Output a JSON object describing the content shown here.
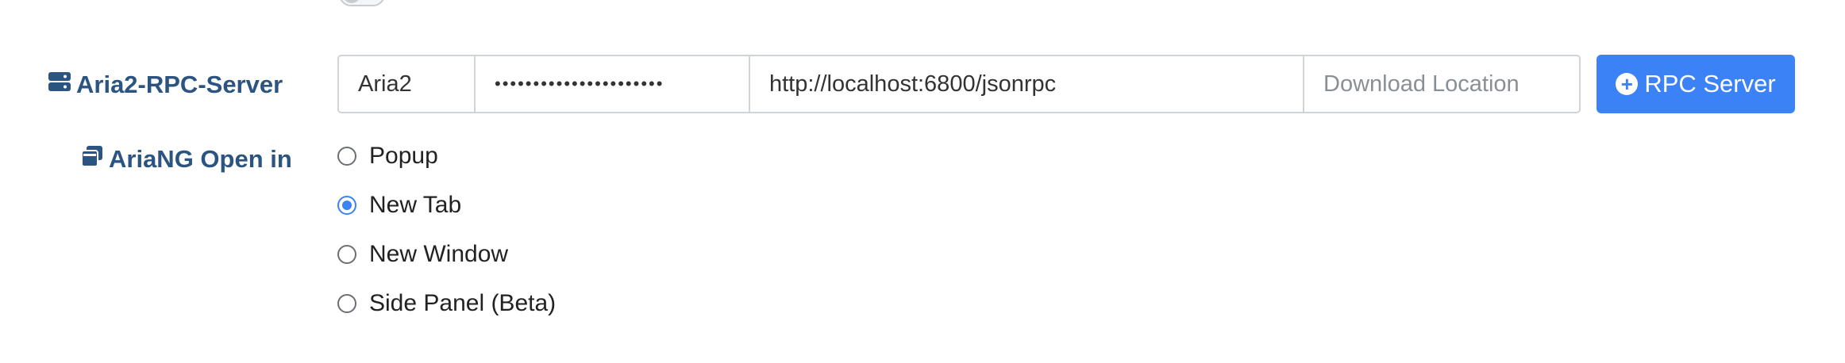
{
  "rpc_server": {
    "label": "Aria2-RPC-Server",
    "icon": "server-icon",
    "name_value": "Aria2",
    "secret_value": "••••••••••••••••••••••",
    "url_value": "http://localhost:6800/jsonrpc",
    "location_placeholder": "Download Location",
    "add_button_label": "RPC Server",
    "accent_color": "#3b82f6"
  },
  "open_in": {
    "label": "AriaNG Open in",
    "icon": "window-restore-icon",
    "options": [
      {
        "label": "Popup",
        "checked": false
      },
      {
        "label": "New Tab",
        "checked": true
      },
      {
        "label": "New Window",
        "checked": false
      },
      {
        "label": "Side Panel (Beta)",
        "checked": false
      }
    ]
  },
  "colors": {
    "label_color": "#2b5580",
    "button_blue": "#3b82f6"
  }
}
